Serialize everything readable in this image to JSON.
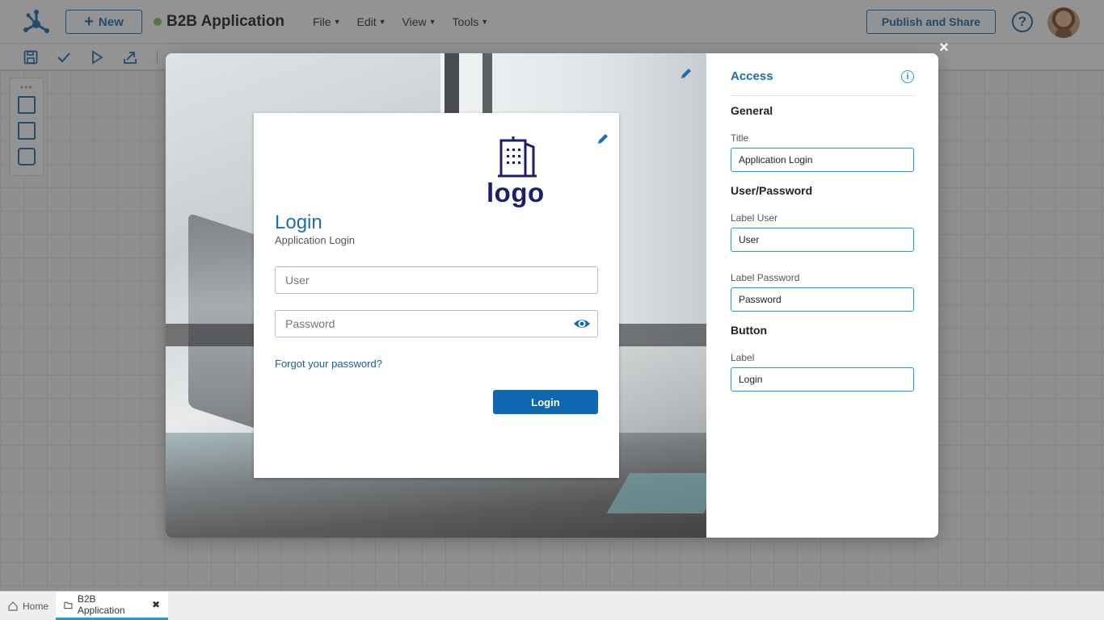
{
  "app": {
    "new_label": "New",
    "name": "B2B Application",
    "status_color": "#8cc34b",
    "accent": "#1a6fb0"
  },
  "menu": [
    {
      "label": "File"
    },
    {
      "label": "Edit"
    },
    {
      "label": "View"
    },
    {
      "label": "Tools"
    }
  ],
  "header": {
    "publish_label": "Publish and Share",
    "help_label": "?"
  },
  "toolbar": {
    "icons": [
      "save-icon",
      "check-icon",
      "play-icon",
      "export-icon"
    ]
  },
  "palette": {
    "icons": [
      "form-icon",
      "note-icon",
      "flow-icon"
    ]
  },
  "modal": {
    "close_label": "×",
    "preview": {
      "logo_text": "logo",
      "login_title": "Login",
      "login_subtitle": "Application Login",
      "user_placeholder": "User",
      "password_placeholder": "Password",
      "forgot_link": "Forgot your password?",
      "login_button": "Login"
    },
    "panel": {
      "title": "Access",
      "general_heading": "General",
      "title_label": "Title",
      "title_value": "Application Login",
      "user_password_heading": "User/Password",
      "label_user_label": "Label User",
      "label_user_value": "User",
      "label_password_label": "Label Password",
      "label_password_value": "Password",
      "button_heading": "Button",
      "button_label_label": "Label",
      "button_label_value": "Login"
    }
  },
  "bottom_tabs": [
    {
      "label": "Home",
      "icon": "home-icon"
    },
    {
      "label": "B2B Application",
      "icon": "folder-icon",
      "active": true
    }
  ]
}
